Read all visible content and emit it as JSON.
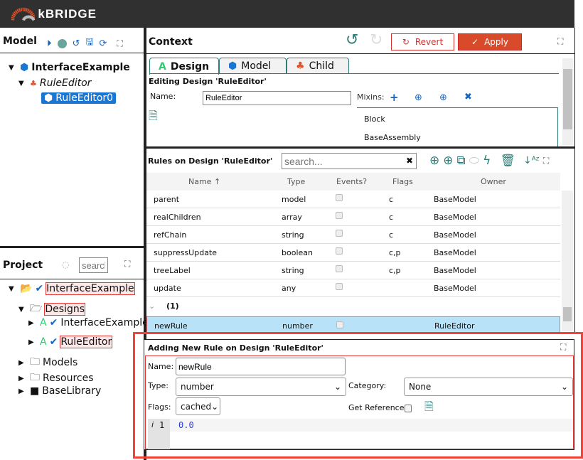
{
  "app": {
    "logo": "kBRIDGE"
  },
  "model_panel": {
    "title": "Model",
    "tree": [
      {
        "label": "InterfaceExample",
        "icon": "cube-icon"
      },
      {
        "label": "RuleEditor",
        "icon": "hierarchy-icon"
      },
      {
        "label": "RuleEditor0",
        "icon": "cube-icon",
        "selected": true
      }
    ]
  },
  "project_panel": {
    "title": "Project",
    "search_placeholder": "search",
    "tree": [
      {
        "label": "InterfaceExample"
      },
      {
        "label": "Designs"
      },
      {
        "label": "InterfaceExample"
      },
      {
        "label": "RuleEditor"
      },
      {
        "label": "Models"
      },
      {
        "label": "Resources"
      },
      {
        "label": "BaseLibrary"
      }
    ]
  },
  "context": {
    "title": "Context",
    "revert": "Revert",
    "apply": "Apply",
    "tabs": [
      {
        "label": "Design",
        "active": true
      },
      {
        "label": "Model"
      },
      {
        "label": "Child"
      }
    ],
    "editing_title": "Editing Design 'RuleEditor'",
    "name_label": "Name:",
    "name_value": "RuleEditor",
    "mixins_label": "Mixins:",
    "mixins": [
      "Block",
      "BaseAssembly"
    ]
  },
  "rules": {
    "title": "Rules on Design 'RuleEditor'",
    "search_placeholder": "search...",
    "columns": [
      "Name ↑",
      "Type",
      "Events?",
      "Flags",
      "Owner"
    ],
    "rows": [
      {
        "name": "parent",
        "type": "model",
        "flags": "c",
        "owner": "BaseModel"
      },
      {
        "name": "realChildren",
        "type": "array",
        "flags": "c",
        "owner": "BaseModel"
      },
      {
        "name": "refChain",
        "type": "string",
        "flags": "c",
        "owner": "BaseModel"
      },
      {
        "name": "suppressUpdate",
        "type": "boolean",
        "flags": "c,p",
        "owner": "BaseModel"
      },
      {
        "name": "treeLabel",
        "type": "string",
        "flags": "c,p",
        "owner": "BaseModel"
      },
      {
        "name": "update",
        "type": "any",
        "flags": "",
        "owner": "BaseModel"
      }
    ],
    "group_label": "(1)",
    "new_row": {
      "name": "newRule",
      "type": "number",
      "flags": "",
      "owner": "RuleEditor"
    }
  },
  "new_rule": {
    "title": "Adding New Rule on Design 'RuleEditor'",
    "name_label": "Name:",
    "name_value": "newRule",
    "type_label": "Type:",
    "type_value": "number",
    "category_label": "Category:",
    "category_value": "None",
    "flags_label": "Flags:",
    "flags_value": "cached",
    "get_reference_label": "Get Reference:",
    "code_line_number": "1",
    "code_text": "0.0"
  },
  "colors": {
    "accent": "#2e7d78",
    "apply": "#d84a2a",
    "highlight": "#e53935",
    "selection": "#1976d2"
  }
}
